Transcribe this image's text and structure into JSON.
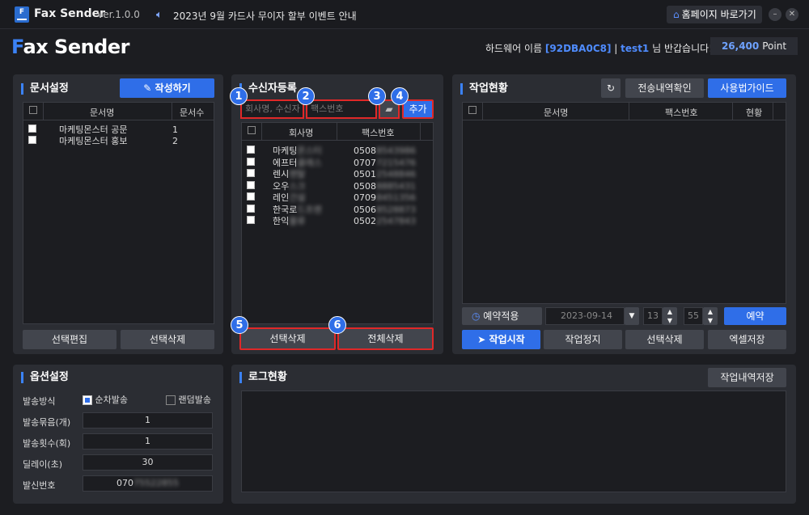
{
  "titlebar": {
    "logo_letter": "F",
    "title": "Fax Sender",
    "version": "Ver.1.0.0",
    "notice": "2023년 9월 카드사 무이자 할부 이벤트 안내",
    "home_button": "홈페이지 바로가기"
  },
  "header": {
    "brand_f": "F",
    "brand_rest": "ax Sender",
    "hw_prefix": "하드웨어 이름",
    "hw_name": "[92DBA0C8]",
    "separator": "|",
    "user": "test1",
    "greeting": "님 반갑습니다!",
    "points": "26,400",
    "points_unit": "Point"
  },
  "doc": {
    "title": "문서설정",
    "write_button": "작성하기",
    "col_name": "문서명",
    "col_count": "문서수",
    "rows": [
      {
        "name": "마케팅몬스터 공문",
        "count": "1"
      },
      {
        "name": "마케팅몬스터 홍보",
        "count": "2"
      }
    ],
    "edit_button": "선택편집",
    "delete_button": "선택삭제"
  },
  "recipients": {
    "title": "수신자등록",
    "name_placeholder": "회사명, 수신자",
    "fax_placeholder": "팩스번호",
    "add_button": "추가",
    "col_company": "회사명",
    "col_fax": "팩스번호",
    "rows": [
      {
        "company": "마케팅",
        "company_hidden": "몬스터",
        "fax": "0508",
        "fax_hidden": "8543986"
      },
      {
        "company": "에프터",
        "company_hidden": "클래스",
        "fax": "0707",
        "fax_hidden": "7215476"
      },
      {
        "company": "렌시",
        "company_hidden": "렌탈",
        "fax": "0501",
        "fax_hidden": "2548846"
      },
      {
        "company": "오우",
        "company_hidden": "스크",
        "fax": "0508",
        "fax_hidden": "8885431"
      },
      {
        "company": "레인",
        "company_hidden": "건설",
        "fax": "0709",
        "fax_hidden": "8451356"
      },
      {
        "company": "한국로",
        "company_hidden": "드프렌",
        "fax": "0506",
        "fax_hidden": "8528873"
      },
      {
        "company": "한익",
        "company_hidden": "물류",
        "fax": "0502",
        "fax_hidden": "2547843"
      }
    ],
    "delete_selected": "선택삭제",
    "delete_all": "전체삭제",
    "badges": [
      "1",
      "2",
      "3",
      "4",
      "5",
      "6"
    ]
  },
  "jobs": {
    "title": "작업현황",
    "history_button": "전송내역확인",
    "guide_button": "사용법가이드",
    "col_doc": "문서명",
    "col_fax": "팩스번호",
    "col_status": "현황",
    "reserve_label": "예약적용",
    "date": "2023-09-14",
    "hour": "13",
    "minute": "55",
    "reserve_button": "예약",
    "start_button": "작업시작",
    "stop_button": "작업정지",
    "delete_button": "선택삭제",
    "excel_button": "엑셀저장"
  },
  "options": {
    "title": "옵션설정",
    "send_method_label": "발송방식",
    "sequential": "순차발송",
    "random": "랜덤발송",
    "bundle_label": "발송묶음(개)",
    "bundle_value": "1",
    "repeat_label": "발송횟수(회)",
    "repeat_value": "1",
    "delay_label": "딜레이(초)",
    "delay_value": "30",
    "sender_label": "발신번호",
    "sender_prefix": "070",
    "sender_hidden": "75522855"
  },
  "log": {
    "title": "로그현황",
    "save_button": "작업내역저장"
  },
  "colors": {
    "accent": "#2f6ee8",
    "highlight": "#e02828",
    "background": "#1c1d21",
    "panel": "#2b2d33"
  }
}
